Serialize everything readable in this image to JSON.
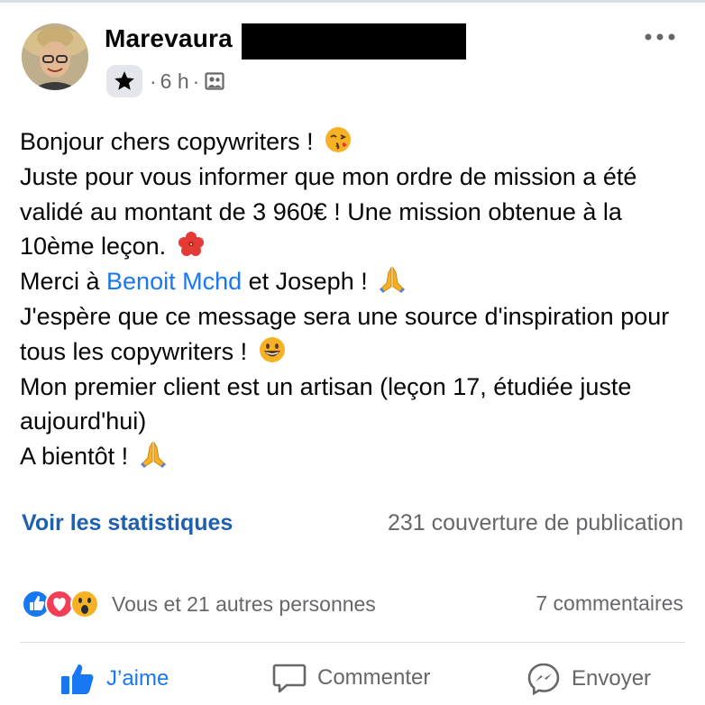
{
  "post": {
    "author": "Marevaura",
    "time": "6 h",
    "separator": "·",
    "lines": [
      {
        "parts": [
          {
            "text": "Bonjour chers copywriters ! "
          }
        ],
        "emoji": "kiss-emoji"
      },
      {
        "parts": [
          {
            "text": "Juste pour vous informer que mon ordre de mission a été validé au montant de 3 960€ ! Une mission obtenue à la 10ème leçon. "
          }
        ],
        "emoji": "hibiscus-emoji"
      },
      {
        "parts": [
          {
            "text": "Merci à "
          },
          {
            "text": "Benoit Mchd",
            "link": true
          },
          {
            "text": " et Joseph ! "
          }
        ],
        "emoji": "praying-hands-emoji"
      },
      {
        "parts": [
          {
            "text": "J'espère que ce message sera une source d'inspiration pour tous les copywriters ! "
          }
        ],
        "emoji": "smile-emoji"
      },
      {
        "parts": [
          {
            "text": "Mon premier client est un artisan (leçon 17, étudiée juste aujourd'hui)"
          }
        ],
        "emoji": null
      },
      {
        "parts": [
          {
            "text": "A bientôt ! "
          }
        ],
        "emoji": "praying-hands-emoji"
      }
    ]
  },
  "stats": {
    "link_label": "Voir les statistiques",
    "reach": "231 couverture de publication"
  },
  "reactions": {
    "icons": [
      "like-reaction-icon",
      "love-reaction-icon",
      "wow-reaction-icon"
    ],
    "summary": "Vous et 21 autres personnes",
    "comments": "7 commentaires"
  },
  "actions": {
    "like": "J’aime",
    "comment": "Commenter",
    "share": "Envoyer"
  },
  "colors": {
    "link": "#1877f2",
    "muted": "#65676b",
    "stats_link": "#1f5fb0"
  }
}
